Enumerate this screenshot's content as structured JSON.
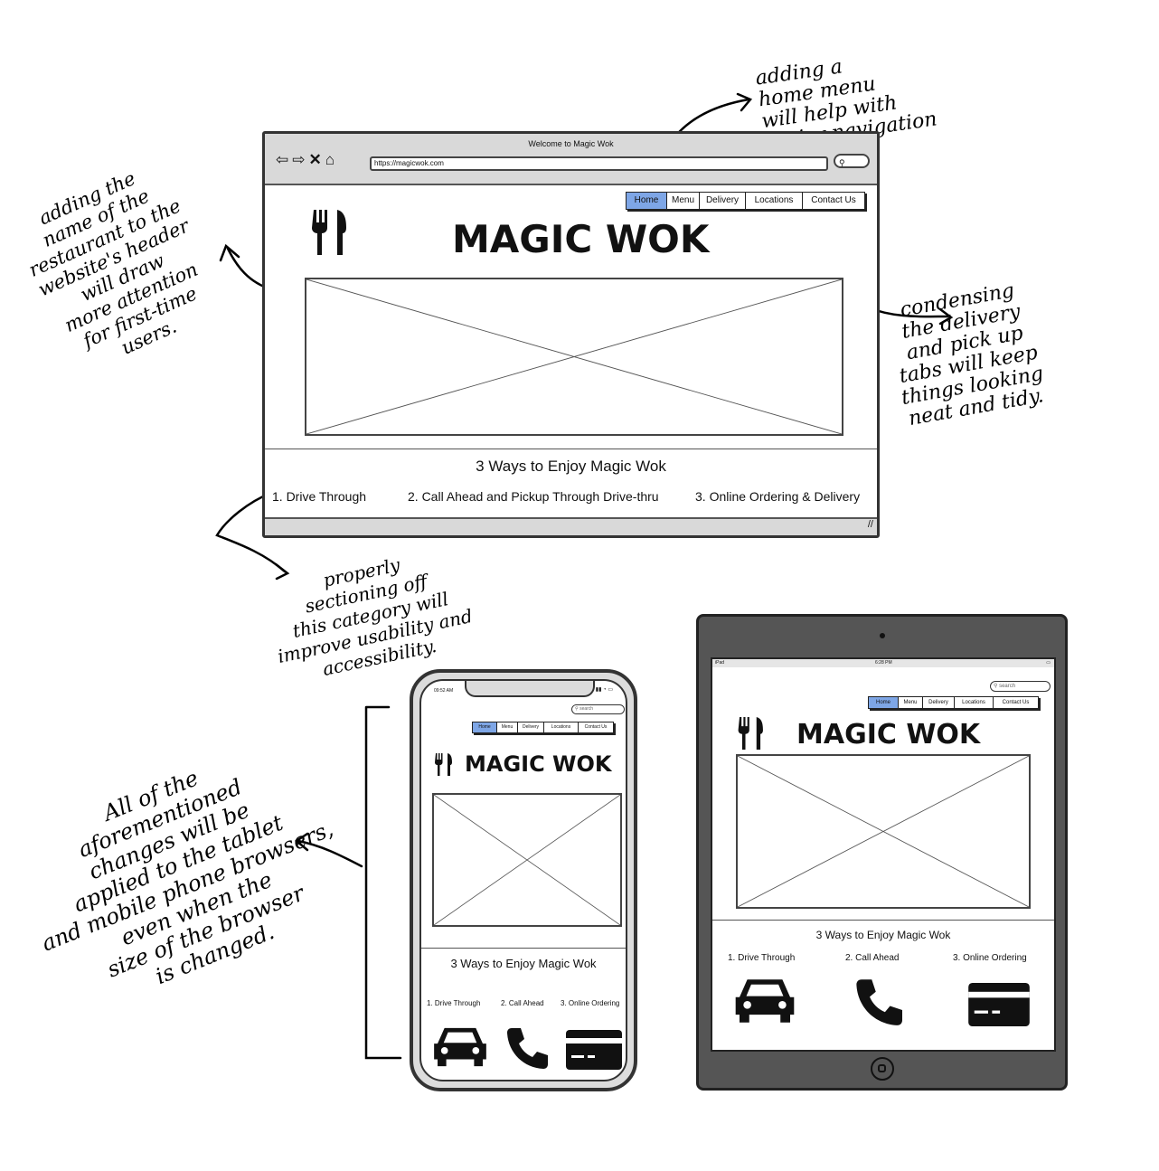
{
  "desktop": {
    "window_title": "Welcome to Magic Wok",
    "url": "https://magicwok.com",
    "nav": [
      "Home",
      "Menu",
      "Delivery",
      "Locations",
      "Contact Us"
    ],
    "active_nav": "Home",
    "logo_text": "MAGIC WOK",
    "section_title": "3 Ways to Enjoy Magic Wok",
    "ways": [
      "1. Drive Through",
      "2. Call Ahead and Pickup Through Drive-thru",
      "3. Online Ordering & Delivery"
    ]
  },
  "phone": {
    "time": "09:52 AM",
    "search_placeholder": "search",
    "nav": [
      "Home",
      "Menu",
      "Delivery",
      "Locations",
      "Contact Us"
    ],
    "logo_text": "MAGIC WOK",
    "section_title": "3 Ways to Enjoy Magic Wok",
    "ways": [
      "1. Drive Through",
      "2. Call Ahead",
      "3. Online Ordering"
    ]
  },
  "tablet": {
    "carrier": "iPad",
    "time": "6:28 PM",
    "search_placeholder": "search",
    "nav": [
      "Home",
      "Menu",
      "Delivery",
      "Locations",
      "Contact Us"
    ],
    "logo_text": "MAGIC WOK",
    "section_title": "3 Ways to Enjoy Magic Wok",
    "ways": [
      "1. Drive Through",
      "2. Call Ahead",
      "3. Online Ordering"
    ]
  },
  "annotations": {
    "home_menu": "adding a\nhome menu\nwill help with\neasier navigation",
    "restaurant_name": "adding the\nname of the\nrestaurant to the\nwebsite's header\nwill draw\nmore attention\nfor first-time\nusers.",
    "condensing": "condensing\nthe delivery\nand pick up\ntabs will keep\nthings looking\nneat and tidy.",
    "sectioning": "properly\nsectioning off\nthis category will\nimprove usability and\naccessibility.",
    "responsive": "All of the\naforementioned\nchanges will be\napplied to the tablet\nand mobile phone browsers,\neven when the\nsize of the browser\nis changed."
  },
  "icons": [
    "fork-knife-icon",
    "car-icon",
    "phone-icon",
    "credit-card-icon",
    "search-icon",
    "back-arrow-icon",
    "forward-arrow-icon",
    "close-icon",
    "home-icon"
  ]
}
